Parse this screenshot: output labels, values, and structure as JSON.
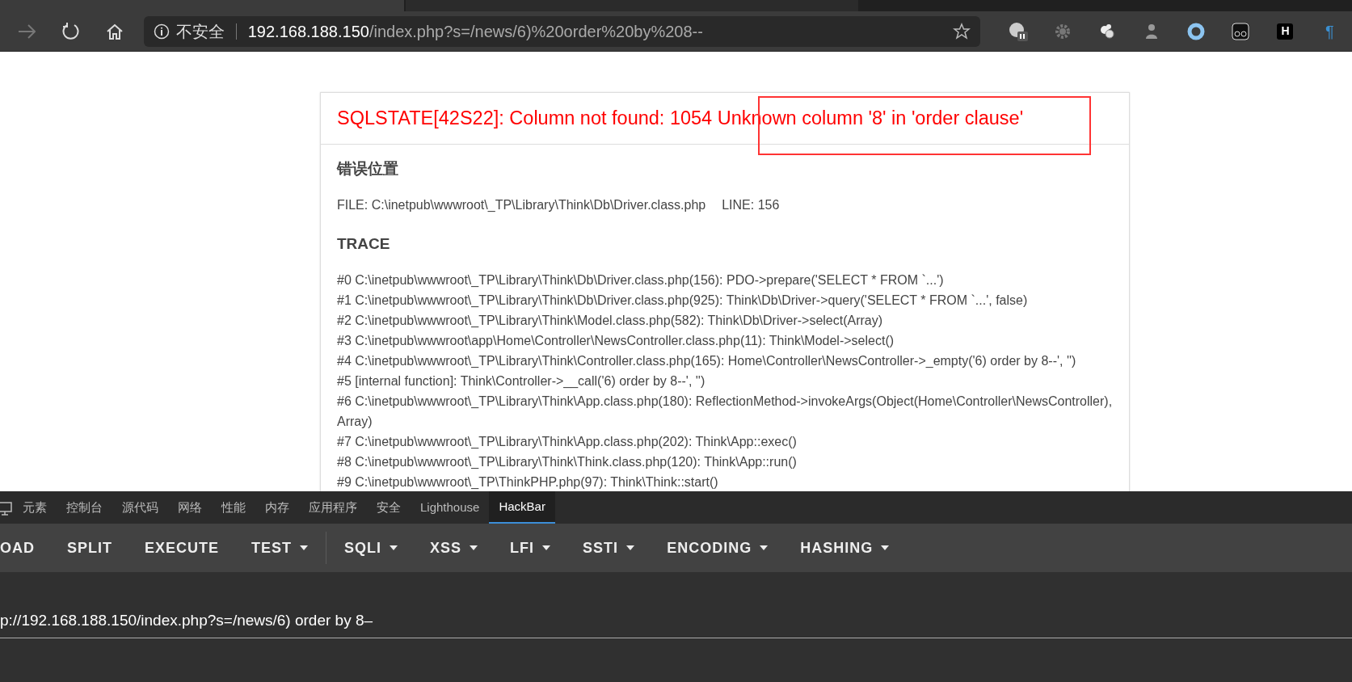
{
  "browser": {
    "security_label": "不安全",
    "url_host": "192.168.188.150",
    "url_path": "/index.php?s=/news/6)%20order%20by%208--",
    "extensions": [
      {
        "kind": "badge"
      },
      {
        "kind": "gear"
      },
      {
        "kind": "bubbles"
      },
      {
        "kind": "figure"
      },
      {
        "kind": "ring"
      },
      {
        "kind": "glasses"
      },
      {
        "kind": "letter",
        "text": "H"
      },
      {
        "kind": "pilcrow",
        "text": "¶"
      }
    ]
  },
  "error_page": {
    "title": "SQLSTATE[42S22]: Column not found: 1054 Unknown column '8' in 'order clause'",
    "location_heading": "错误位置",
    "file_label": "FILE: C:\\inetpub\\wwwroot\\_TP\\Library\\Think\\Db\\Driver.class.php",
    "line_label": "LINE: 156",
    "trace_heading": "TRACE",
    "trace": [
      "#0 C:\\inetpub\\wwwroot\\_TP\\Library\\Think\\Db\\Driver.class.php(156): PDO->prepare('SELECT * FROM `...')",
      "#1 C:\\inetpub\\wwwroot\\_TP\\Library\\Think\\Db\\Driver.class.php(925): Think\\Db\\Driver->query('SELECT * FROM `...', false)",
      "#2 C:\\inetpub\\wwwroot\\_TP\\Library\\Think\\Model.class.php(582): Think\\Db\\Driver->select(Array)",
      "#3 C:\\inetpub\\wwwroot\\app\\Home\\Controller\\NewsController.class.php(11): Think\\Model->select()",
      "#4 C:\\inetpub\\wwwroot\\_TP\\Library\\Think\\Controller.class.php(165): Home\\Controller\\NewsController->_empty('6) order by 8--', '')",
      "#5 [internal function]: Think\\Controller->__call('6) order by 8--', '')",
      "#6 C:\\inetpub\\wwwroot\\_TP\\Library\\Think\\App.class.php(180): ReflectionMethod->invokeArgs(Object(Home\\Controller\\NewsController), Array)",
      "#7 C:\\inetpub\\wwwroot\\_TP\\Library\\Think\\App.class.php(202): Think\\App::exec()",
      "#8 C:\\inetpub\\wwwroot\\_TP\\Library\\Think\\Think.class.php(120): Think\\App::run()",
      "#9 C:\\inetpub\\wwwroot\\_TP\\ThinkPHP.php(97): Think\\Think::start()"
    ]
  },
  "devtools": {
    "tabs": [
      {
        "label": "元素",
        "selected": false
      },
      {
        "label": "控制台",
        "selected": false
      },
      {
        "label": "源代码",
        "selected": false
      },
      {
        "label": "网络",
        "selected": false
      },
      {
        "label": "性能",
        "selected": false
      },
      {
        "label": "内存",
        "selected": false
      },
      {
        "label": "应用程序",
        "selected": false
      },
      {
        "label": "安全",
        "selected": false
      },
      {
        "label": "Lighthouse",
        "selected": false
      },
      {
        "label": "HackBar",
        "selected": true
      }
    ],
    "hackbar_buttons": [
      {
        "label": "OAD",
        "dropdown": false
      },
      {
        "label": "SPLIT",
        "dropdown": false
      },
      {
        "label": "EXECUTE",
        "dropdown": false
      },
      {
        "label": "TEST",
        "dropdown": true
      },
      {
        "label": "SQLI",
        "dropdown": true
      },
      {
        "label": "XSS",
        "dropdown": true
      },
      {
        "label": "LFI",
        "dropdown": true
      },
      {
        "label": "SSTI",
        "dropdown": true
      },
      {
        "label": "ENCODING",
        "dropdown": true
      },
      {
        "label": "HASHING",
        "dropdown": true
      }
    ],
    "url_value": "p://192.168.188.150/index.php?s=/news/6) order by 8–"
  }
}
